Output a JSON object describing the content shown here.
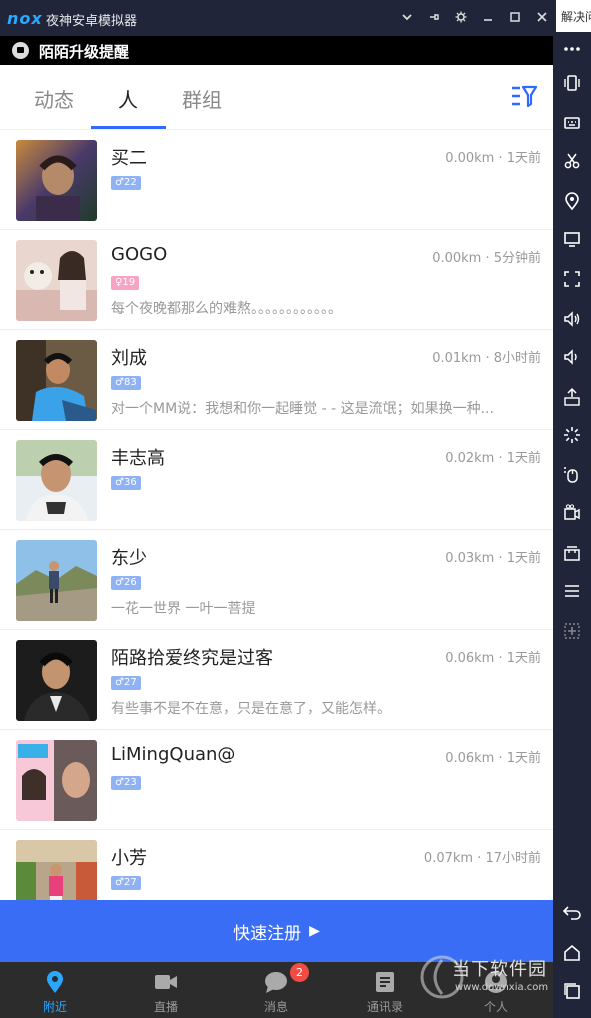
{
  "emulator": {
    "logo": "nox",
    "title": "夜神安卓模拟器",
    "side_peek": "解决问"
  },
  "screen": {
    "notification": "陌陌升级提醒",
    "tabs": [
      "动态",
      "人",
      "群组"
    ],
    "active_tab": "人",
    "accent": "#2f6bff",
    "users": [
      {
        "name": "买二",
        "gender": "male",
        "gender_symbol": "♂",
        "age": "22",
        "meta": "0.00km · 1天前",
        "signature": ""
      },
      {
        "name": "GOGO",
        "gender": "female",
        "gender_symbol": "♀",
        "age": "19",
        "meta": "0.00km · 5分钟前",
        "signature": "每个夜晚都那么的难熬。。。。。。。。。。。。"
      },
      {
        "name": "刘成",
        "gender": "male",
        "gender_symbol": "♂",
        "age": "83",
        "meta": "0.01km · 8小时前",
        "signature": "对一个MM说：我想和你一起睡觉 -  - 这是流氓；如果换一种..."
      },
      {
        "name": "丰志高",
        "gender": "male",
        "gender_symbol": "♂",
        "age": "36",
        "meta": "0.02km · 1天前",
        "signature": ""
      },
      {
        "name": "东少",
        "gender": "male",
        "gender_symbol": "♂",
        "age": "26",
        "meta": "0.03km · 1天前",
        "signature": "一花一世界 一叶一菩提"
      },
      {
        "name": "陌路拾爱终究是过客",
        "gender": "male",
        "gender_symbol": "♂",
        "age": "27",
        "meta": "0.06km · 1天前",
        "signature": "有些事不是不在意，只是在意了，又能怎样。"
      },
      {
        "name": "LiMingQuan@",
        "gender": "male",
        "gender_symbol": "♂",
        "age": "23",
        "meta": "0.06km · 1天前",
        "signature": ""
      },
      {
        "name": "小芳",
        "gender": "male",
        "gender_symbol": "♂",
        "age": "27",
        "meta": "0.07km · 17小时前",
        "signature": ""
      }
    ],
    "register_button": "快速注册",
    "register_icon": "play-icon",
    "bottom_nav": [
      {
        "label": "附近",
        "icon": "location-pin-icon",
        "active": true
      },
      {
        "label": "直播",
        "icon": "video-camera-icon",
        "active": false
      },
      {
        "label": "消息",
        "icon": "chat-bubble-icon",
        "active": false,
        "badge": "2"
      },
      {
        "label": "通讯录",
        "icon": "contacts-icon",
        "active": false
      },
      {
        "label": "个人",
        "icon": "person-icon",
        "active": false
      }
    ]
  },
  "watermark": {
    "text": "当下软件园",
    "url": "www.downxia.com"
  }
}
